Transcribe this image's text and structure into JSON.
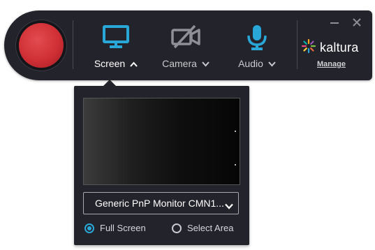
{
  "colors": {
    "toolbar_bg": "#23232b",
    "record_red": "#cf2f35",
    "accent_blue": "#29a8d8",
    "muted_gray": "#8f8f98"
  },
  "toolbar": {
    "record_button": {
      "icon": "record-circle"
    },
    "sources": [
      {
        "label": "Screen",
        "icon": "monitor-icon",
        "state": "active",
        "chevron": "up"
      },
      {
        "label": "Camera",
        "icon": "camera-off-icon",
        "state": "disabled",
        "chevron": "down"
      },
      {
        "label": "Audio",
        "icon": "microphone-icon",
        "state": "active",
        "chevron": "down"
      }
    ],
    "window_controls": {
      "minimize": "minimize-icon",
      "close": "close-icon"
    },
    "brand": {
      "name": "kaltura",
      "logo": "kaltura-spark-logo"
    },
    "manage_label": "Manage"
  },
  "screen_panel": {
    "monitor_select": {
      "value": "Generic PnP Monitor CMN1..."
    },
    "modes": [
      {
        "label": "Full Screen",
        "selected": true
      },
      {
        "label": "Select Area",
        "selected": false
      }
    ]
  }
}
